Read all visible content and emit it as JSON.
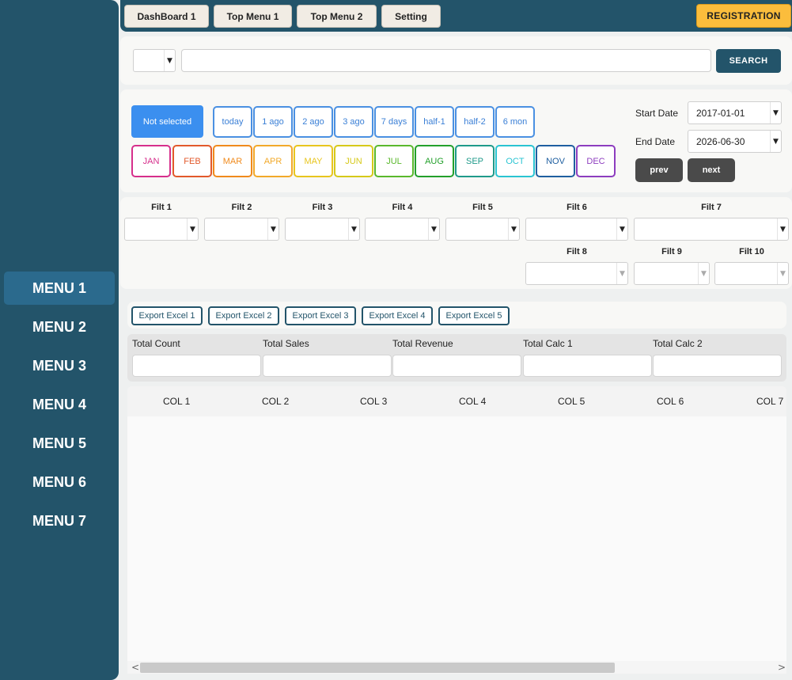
{
  "topbar": {
    "tabs": [
      "DashBoard 1",
      "Top Menu 1",
      "Top Menu 2",
      "Setting"
    ],
    "register_label": "REGISTRATION"
  },
  "sidebar": {
    "items": [
      "MENU 1",
      "MENU 2",
      "MENU 3",
      "MENU 4",
      "MENU 5",
      "MENU 6",
      "MENU 7"
    ],
    "active_index": 0
  },
  "search": {
    "type_value": "",
    "query_value": "",
    "button_label": "SEARCH"
  },
  "period": {
    "not_selected_label": "Not selected",
    "quick_ranges": [
      "today",
      "1 ago",
      "2 ago",
      "3 ago",
      "7 days",
      "half-1",
      "half-2",
      "6 mon"
    ],
    "months": [
      "JAN",
      "FEB",
      "MAR",
      "APR",
      "MAY",
      "JUN",
      "JUL",
      "AUG",
      "SEP",
      "OCT",
      "NOV",
      "DEC"
    ],
    "month_colors": [
      "#d62f8c",
      "#e2592b",
      "#f08a1c",
      "#f2a92a",
      "#e8c51e",
      "#d6c91a",
      "#5ab82c",
      "#23a02b",
      "#1f9a8a",
      "#2ac4d2",
      "#1f5fa0",
      "#8d3dbf"
    ],
    "start_date_label": "Start Date",
    "start_date": "2017-01-01",
    "end_date_label": "End Date",
    "end_date": "2026-06-30",
    "prev_label": "prev",
    "next_label": "next"
  },
  "filters": {
    "labels": [
      "Filt 1",
      "Filt 2",
      "Filt 3",
      "Filt 4",
      "Filt 5",
      "Filt 6",
      "Filt 7",
      "Filt 8",
      "Filt 9",
      "Filt 10"
    ]
  },
  "exports": [
    "Export Excel 1",
    "Export Excel 2",
    "Export Excel 3",
    "Export Excel 4",
    "Export Excel 5"
  ],
  "totals": {
    "labels": [
      "Total Count",
      "Total Sales",
      "Total Revenue",
      "Total Calc 1",
      "Total Calc 2"
    ]
  },
  "table": {
    "columns": [
      "COL 1",
      "COL 2",
      "COL 3",
      "COL 4",
      "COL 5",
      "COL 6",
      "COL 7"
    ]
  },
  "scrollbar": {
    "left_arrow": "<",
    "right_arrow": ">"
  }
}
